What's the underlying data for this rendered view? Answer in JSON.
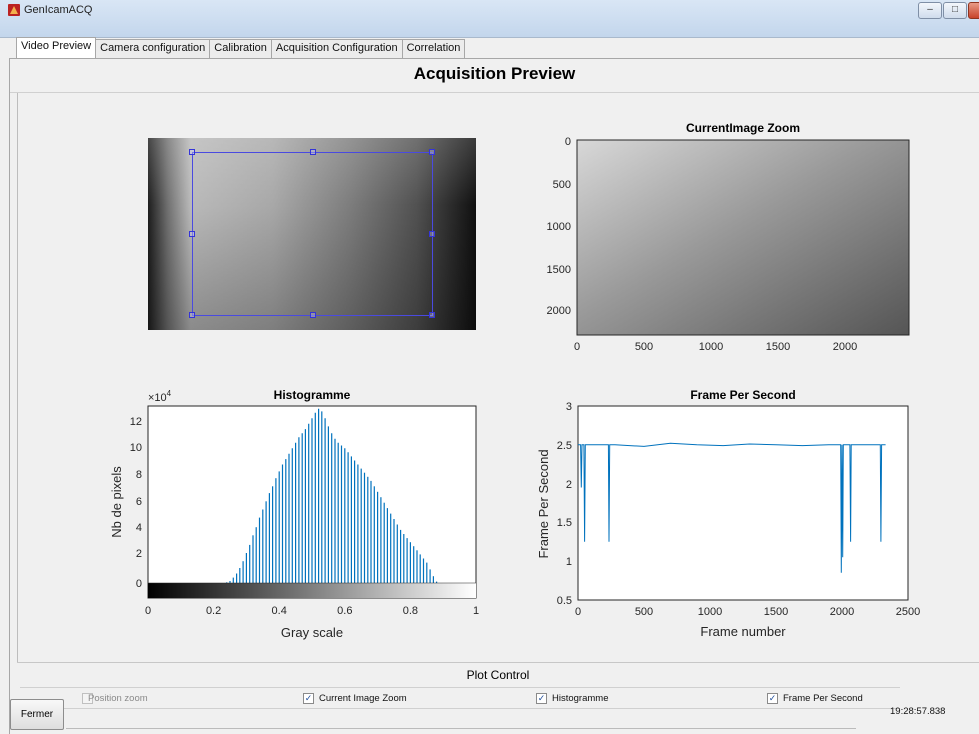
{
  "window": {
    "title": "GenIcamACQ",
    "minimize_symbol": "–",
    "maximize_symbol": "□",
    "close_symbol": ""
  },
  "tabs": [
    {
      "label": "Video Preview",
      "active": true
    },
    {
      "label": "Camera configuration",
      "active": false
    },
    {
      "label": "Calibration",
      "active": false
    },
    {
      "label": "Acquisition Configuration",
      "active": false
    },
    {
      "label": "Correlation",
      "active": false
    }
  ],
  "main": {
    "title": "Acquisition Preview",
    "preview_image": {
      "icon": "camera-preview-image"
    }
  },
  "charts": {
    "zoom": {
      "title": "CurrentImage Zoom",
      "x_ticks": [
        "0",
        "500",
        "1000",
        "1500",
        "2000"
      ],
      "y_ticks": [
        "0",
        "500",
        "1000",
        "1500",
        "2000"
      ]
    },
    "histogram": {
      "title": "Histogramme",
      "exponent_label": "×10",
      "exponent_power": "4",
      "ylabel": "Nb de pixels",
      "xlabel": "Gray scale",
      "x_ticks": [
        "0",
        "0.2",
        "0.4",
        "0.6",
        "0.8",
        "1"
      ],
      "y_ticks": [
        "0",
        "2",
        "4",
        "6",
        "8",
        "10",
        "12"
      ]
    },
    "fps": {
      "title": "Frame Per Second",
      "ylabel": "Frame Per Second",
      "xlabel": "Frame number",
      "x_ticks": [
        "0",
        "500",
        "1000",
        "1500",
        "2000",
        "2500"
      ],
      "y_ticks": [
        "0.5",
        "1",
        "1.5",
        "2",
        "2.5",
        "3"
      ]
    }
  },
  "chart_data": [
    {
      "type": "heatmap",
      "title": "CurrentImage Zoom",
      "xlim": [
        0,
        2448
      ],
      "ylim": [
        0,
        2300
      ]
    },
    {
      "type": "bar",
      "title": "Histogramme",
      "xlabel": "Gray scale",
      "ylabel": "Nb de pixels",
      "xlim": [
        0,
        1
      ],
      "ylim": [
        0,
        130000
      ],
      "x": [
        0.24,
        0.25,
        0.26,
        0.27,
        0.28,
        0.29,
        0.3,
        0.31,
        0.32,
        0.33,
        0.34,
        0.35,
        0.36,
        0.37,
        0.38,
        0.39,
        0.4,
        0.41,
        0.42,
        0.43,
        0.44,
        0.45,
        0.46,
        0.47,
        0.48,
        0.49,
        0.5,
        0.51,
        0.52,
        0.53,
        0.54,
        0.55,
        0.56,
        0.57,
        0.58,
        0.59,
        0.6,
        0.61,
        0.62,
        0.63,
        0.64,
        0.65,
        0.66,
        0.67,
        0.68,
        0.69,
        0.7,
        0.71,
        0.72,
        0.73,
        0.74,
        0.75,
        0.76,
        0.77,
        0.78,
        0.79,
        0.8,
        0.81,
        0.82,
        0.83,
        0.84,
        0.85,
        0.86,
        0.87,
        0.88
      ],
      "values": [
        500,
        1500,
        4000,
        7000,
        11000,
        16000,
        22000,
        28000,
        35000,
        41000,
        48000,
        54000,
        60000,
        66000,
        71000,
        77000,
        82000,
        87000,
        91000,
        95000,
        99000,
        103000,
        107000,
        110000,
        113000,
        117000,
        121000,
        125000,
        128000,
        126000,
        121000,
        115000,
        110000,
        106000,
        103000,
        101000,
        99000,
        96000,
        93000,
        90000,
        87000,
        84000,
        81000,
        78000,
        75000,
        71000,
        67000,
        63000,
        59000,
        55000,
        51000,
        47000,
        43000,
        39000,
        36000,
        33000,
        30000,
        27000,
        24000,
        21000,
        18000,
        15000,
        10000,
        5000,
        1000
      ]
    },
    {
      "type": "line",
      "title": "Frame Per Second",
      "xlabel": "Frame number",
      "ylabel": "Frame Per Second",
      "xlim": [
        0,
        2500
      ],
      "ylim": [
        0.5,
        3
      ],
      "x": [
        0,
        20,
        25,
        30,
        45,
        50,
        55,
        80,
        200,
        230,
        235,
        240,
        280,
        500,
        700,
        900,
        1100,
        1300,
        1500,
        1700,
        1900,
        1990,
        1995,
        2000,
        2005,
        2010,
        2030,
        2060,
        2065,
        2070,
        2100,
        2150,
        2200,
        2250,
        2290,
        2295,
        2300,
        2330
      ],
      "values": [
        2.5,
        2.5,
        1.95,
        2.5,
        2.5,
        1.25,
        2.5,
        2.5,
        2.5,
        2.5,
        1.25,
        2.5,
        2.5,
        2.48,
        2.52,
        2.5,
        2.49,
        2.51,
        2.5,
        2.49,
        2.5,
        2.5,
        0.85,
        2.5,
        1.05,
        2.5,
        2.5,
        2.5,
        1.25,
        2.5,
        2.5,
        2.5,
        2.5,
        2.5,
        2.5,
        1.25,
        2.5,
        2.5
      ]
    }
  ],
  "plot_control": {
    "title": "Plot Control",
    "options": [
      {
        "label": "Position zoom",
        "checked": false,
        "enabled": false
      },
      {
        "label": "Current Image Zoom",
        "checked": true,
        "enabled": true
      },
      {
        "label": "Histogramme",
        "checked": true,
        "enabled": true
      },
      {
        "label": "Frame Per Second",
        "checked": true,
        "enabled": true
      }
    ]
  },
  "footer": {
    "close_label": "Fermer",
    "time": "19:28:57.838",
    "check_mark": "✓"
  },
  "colors": {
    "series": "#0072bd",
    "roi": "#3434d8"
  }
}
